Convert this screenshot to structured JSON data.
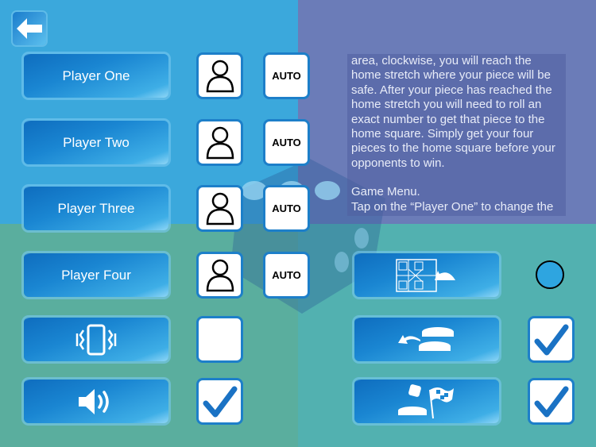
{
  "colors": {
    "q_top_left": "#3ba8dc",
    "q_top_right": "#6b7cb8",
    "q_bottom_left": "#5aae9e",
    "q_bottom_right": "#52b1b0",
    "accent": "#1a86d2"
  },
  "back_button": {
    "icon": "arrow-left-icon"
  },
  "players": [
    {
      "label": "Player One",
      "type_icon": "person-icon",
      "auto_label": "AUTO"
    },
    {
      "label": "Player Two",
      "type_icon": "person-icon",
      "auto_label": "AUTO"
    },
    {
      "label": "Player Three",
      "type_icon": "person-icon",
      "auto_label": "AUTO"
    },
    {
      "label": "Player Four",
      "type_icon": "person-icon",
      "auto_label": "AUTO"
    }
  ],
  "settings_left": [
    {
      "icon": "vibrate-phone-icon",
      "checked": false
    },
    {
      "icon": "speaker-icon",
      "checked": true
    }
  ],
  "settings_right": [
    {
      "icon": "board-rotate-icon",
      "control": "radio",
      "checked": false
    },
    {
      "icon": "pieces-return-icon",
      "control": "checkbox",
      "checked": true
    },
    {
      "icon": "dice-finish-flag-icon",
      "control": "checkbox",
      "checked": true
    }
  ],
  "help_text": {
    "paragraph1": "area, clockwise, you will reach the home stretch where your piece will be safe. After your piece has reached the home stretch you will need to roll an exact number to get that piece to the home square. Simply get your four pieces to the home square before your opponents to win.",
    "heading": "Game Menu.",
    "paragraph2": "Tap on the “Player One” to change the"
  }
}
